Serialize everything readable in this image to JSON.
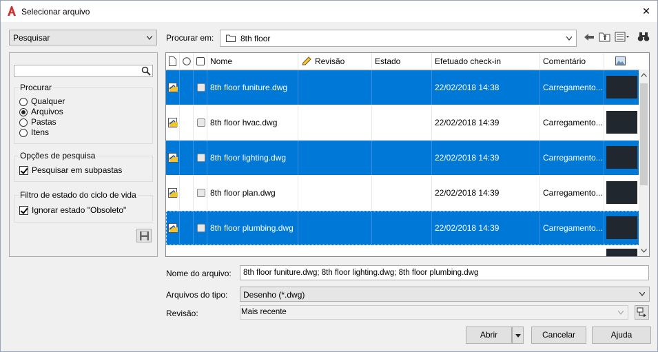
{
  "window": {
    "title": "Selecionar arquivo",
    "close_glyph": "✕"
  },
  "left": {
    "search_mode": "Pesquisar",
    "search_placeholder": "",
    "procurar": {
      "legend": "Procurar",
      "options": [
        "Qualquer",
        "Arquivos",
        "Pastas",
        "Itens"
      ],
      "selected": "Arquivos"
    },
    "opcoes": {
      "legend": "Opções de pesquisa",
      "subfolders_label": "Pesquisar em subpastas",
      "subfolders_checked": true
    },
    "filtro": {
      "legend": "Filtro de estado do ciclo de vida",
      "obsolete_label": "Ignorar estado \"Obsoleto\"",
      "obsolete_checked": true
    }
  },
  "toolbar": {
    "look_in_label": "Procurar em:",
    "look_in_value": "8th floor"
  },
  "grid": {
    "columns": [
      "Nome",
      "Revisão",
      "Estado",
      "Efetuado check-in",
      "Comentário"
    ],
    "rows": [
      {
        "name": "8th floor funiture.dwg",
        "revision": "",
        "state": "",
        "checkin": "22/02/2018 14:38",
        "comment": "Carregamento...",
        "selected": true
      },
      {
        "name": "8th floor hvac.dwg",
        "revision": "",
        "state": "",
        "checkin": "22/02/2018 14:39",
        "comment": "Carregamento...",
        "selected": false
      },
      {
        "name": "8th floor lighting.dwg",
        "revision": "",
        "state": "",
        "checkin": "22/02/2018 14:39",
        "comment": "Carregamento...",
        "selected": true
      },
      {
        "name": "8th floor plan.dwg",
        "revision": "",
        "state": "",
        "checkin": "22/02/2018 14:39",
        "comment": "Carregamento...",
        "selected": false
      },
      {
        "name": "8th floor plumbing.dwg",
        "revision": "",
        "state": "",
        "checkin": "22/02/2018 14:39",
        "comment": "Carregamento...",
        "selected": true
      }
    ]
  },
  "form": {
    "filename_label": "Nome do arquivo:",
    "filename_value": "8th floor funiture.dwg; 8th floor lighting.dwg; 8th floor plumbing.dwg",
    "filetype_label": "Arquivos do tipo:",
    "filetype_value": "Desenho (*.dwg)",
    "revision_label": "Revisão:",
    "revision_value": "Mais recente"
  },
  "buttons": {
    "open": "Abrir",
    "cancel": "Cancelar",
    "help": "Ajuda"
  },
  "colors": {
    "selection": "#0078d7",
    "thumbnail": "#21272e",
    "accent_red": "#d32f2f"
  }
}
